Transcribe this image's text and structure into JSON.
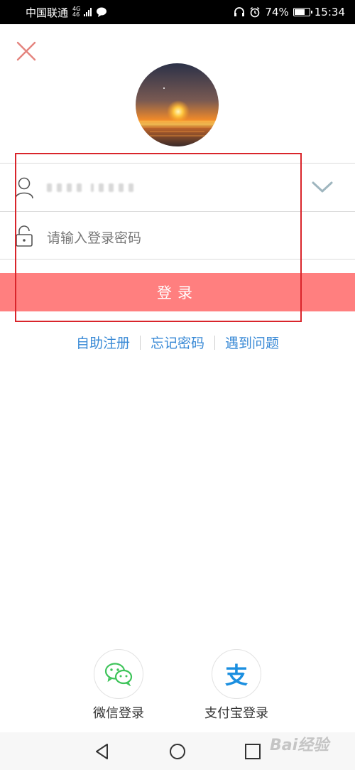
{
  "status": {
    "carrier": "中国联通",
    "network_top": "4G",
    "network_bottom": "46",
    "battery": "74%",
    "battery_level": 0.74,
    "time": "15:34"
  },
  "icons": {
    "close": "close-icon",
    "user": "user-icon",
    "lock": "lock-icon",
    "chevron": "chevron-down-icon",
    "wechat": "wechat-icon",
    "alipay": "alipay-icon"
  },
  "form": {
    "password_placeholder": "请输入登录密码"
  },
  "login": {
    "label": "登录"
  },
  "links": {
    "register": "自助注册",
    "forgot": "忘记密码",
    "problem": "遇到问题"
  },
  "social": {
    "wechat_label": "微信登录",
    "alipay_label": "支付宝登录",
    "alipay_glyph": "支"
  },
  "watermark": "Bai经验",
  "colors": {
    "login_button": "#ff7f7f",
    "link": "#3a8ad6",
    "annotation_box": "#d9252b"
  }
}
